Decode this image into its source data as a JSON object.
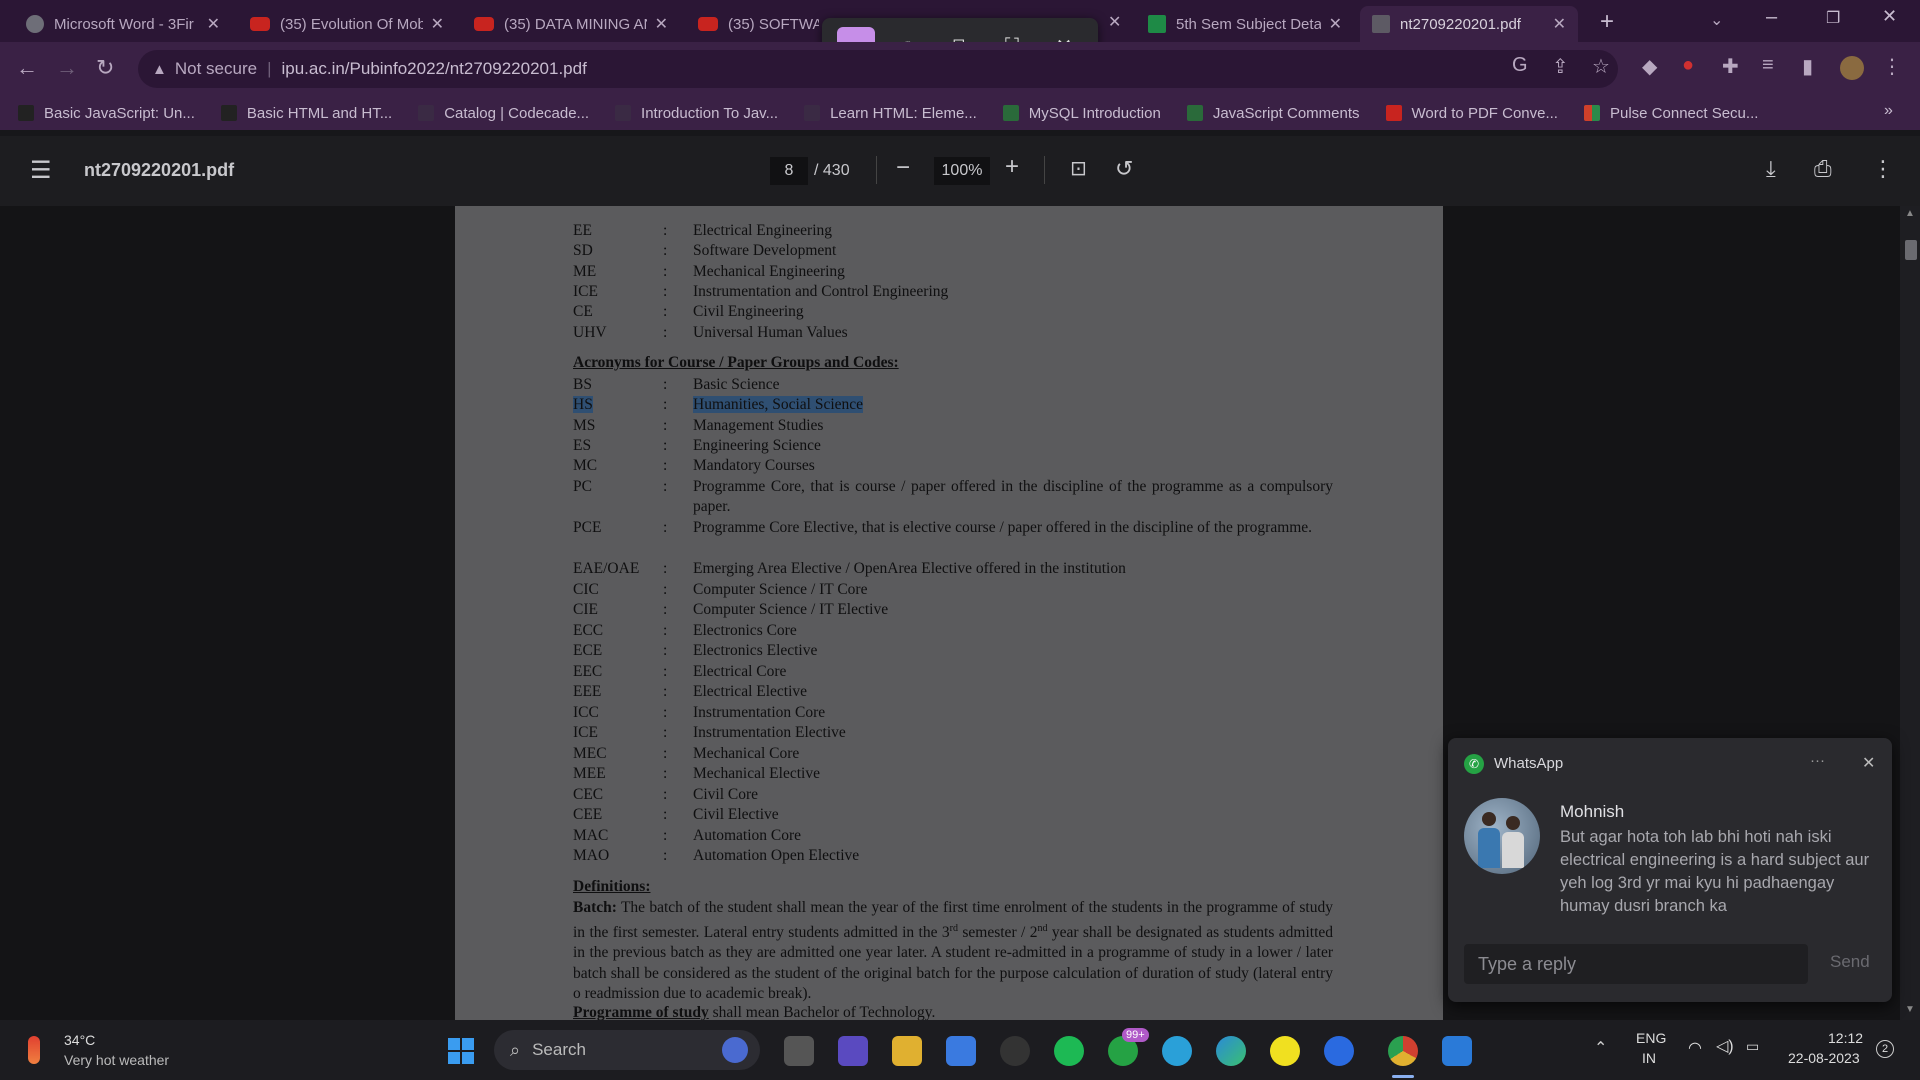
{
  "tabs": [
    {
      "title": "Microsoft Word - 3Fir",
      "icon": "generic-page-icon"
    },
    {
      "title": "(35) Evolution Of Mob",
      "icon": "youtube-icon"
    },
    {
      "title": "(35) DATA MINING AN",
      "icon": "youtube-icon"
    },
    {
      "title": "(35) SOFTWAR",
      "icon": "youtube-icon"
    },
    {
      "title": "5th Sem Subject Deta",
      "icon": "sheets-icon"
    },
    {
      "title": "nt2709220201.pdf",
      "icon": "pdf-doc-icon"
    }
  ],
  "address": {
    "security": "Not secure",
    "url": "ipu.ac.in/Pubinfo2022/nt2709220201.pdf"
  },
  "bookmarks": [
    "Basic JavaScript: Un...",
    "Basic HTML and HT...",
    "Catalog | Codecade...",
    "Introduction To Jav...",
    "Learn HTML: Eleme...",
    "MySQL Introduction",
    "JavaScript Comments",
    "Word to PDF Conve...",
    "Pulse Connect Secu..."
  ],
  "pdf": {
    "filename": "nt2709220201.pdf",
    "page_current": "8",
    "page_total": "/ 430",
    "zoom": "100%"
  },
  "document": {
    "dept_rows": [
      {
        "abbr": "EE",
        "desc": "Electrical Engineering"
      },
      {
        "abbr": "SD",
        "desc": "Software Development"
      },
      {
        "abbr": "ME",
        "desc": "Mechanical Engineering"
      },
      {
        "abbr": "ICE",
        "desc": "Instrumentation and Control Engineering"
      },
      {
        "abbr": "CE",
        "desc": "Civil Engineering"
      },
      {
        "abbr": "UHV",
        "desc": "Universal Human Values"
      }
    ],
    "heading_acronyms": "Acronyms for Course / Paper Groups and Codes:",
    "code_rows": [
      {
        "abbr": "BS",
        "desc": "Basic Science"
      },
      {
        "abbr": "HS",
        "desc": "Humanities, Social Science"
      },
      {
        "abbr": "MS",
        "desc": "Management Studies"
      },
      {
        "abbr": "ES",
        "desc": "Engineering Science"
      },
      {
        "abbr": "MC",
        "desc": "Mandatory Courses"
      },
      {
        "abbr": "PC",
        "desc": "Programme Core, that is course / paper offered in the discipline of the programme as a compulsory paper."
      },
      {
        "abbr": "PCE",
        "desc": "Programme Core Elective, that is elective course / paper offered in the discipline of the programme."
      },
      {
        "abbr": "EAE/OAE",
        "desc": "Emerging Area Elective / OpenArea Elective offered in the institution"
      },
      {
        "abbr": "CIC",
        "desc": "Computer Science / IT Core"
      },
      {
        "abbr": "CIE",
        "desc": "Computer Science / IT Elective"
      },
      {
        "abbr": "ECC",
        "desc": "Electronics Core"
      },
      {
        "abbr": "ECE",
        "desc": "Electronics Elective"
      },
      {
        "abbr": "EEC",
        "desc": "Electrical Core"
      },
      {
        "abbr": "EEE",
        "desc": "Electrical Elective"
      },
      {
        "abbr": "ICC",
        "desc": "Instrumentation Core"
      },
      {
        "abbr": "ICE",
        "desc": "Instrumentation Elective"
      },
      {
        "abbr": "MEC",
        "desc": "Mechanical Core"
      },
      {
        "abbr": "MEE",
        "desc": "Mechanical Elective"
      },
      {
        "abbr": "CEC",
        "desc": "Civil Core"
      },
      {
        "abbr": "CEE",
        "desc": "Civil Elective"
      },
      {
        "abbr": "MAC",
        "desc": "Automation Core"
      },
      {
        "abbr": "MAO",
        "desc": "Automation Open Elective"
      }
    ],
    "heading_definitions": "Definitions:",
    "batch_label": "Batch:",
    "batch_text_1": "The batch of the student shall mean the year of the first time enrolment of the students in the programme of study in the first semester. Lateral entry students admitted in the 3",
    "batch_sup_1": "rd",
    "batch_text_2": " semester / 2",
    "batch_sup_2": "nd",
    "batch_text_3": " year shall be designated as students admitted in the previous batch as they are admitted one year later. A student re-admitted in a programme of study in a lower / later batch shall be considered as the student of the original batch for the purpose calculation of duration of study (lateral entry o readmission due to academic break).",
    "programme_label": "Programme of study",
    "programme_text": " shall mean Bachelor of Technology."
  },
  "whatsapp": {
    "app": "WhatsApp",
    "sender": "Mohnish",
    "message": "But agar hota toh lab bhi hoti nah iski electrical engineering is a hard subject aur yeh log 3rd yr mai kyu hi padhaengay humay dusri branch ka",
    "reply_placeholder": "Type a reply",
    "send": "Send",
    "more": "···"
  },
  "taskbar": {
    "weather_temp": "34°C",
    "weather_text": "Very hot weather",
    "search": "Search",
    "whatsapp_badge": "99+",
    "lang_1": "ENG",
    "lang_2": "IN",
    "time": "12:12",
    "date": "22-08-2023",
    "notif_count": "2"
  }
}
